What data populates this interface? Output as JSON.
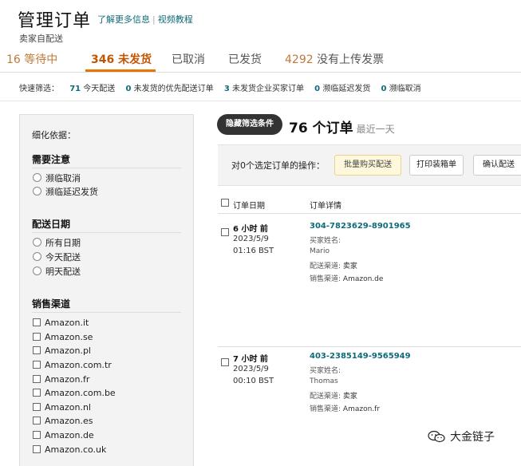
{
  "header": {
    "title": "管理订单",
    "learn_more": "了解更多信息",
    "video": "视频教程",
    "subtitle": "卖家自配送"
  },
  "tabs": {
    "t1": "16 等待中",
    "t2": "346 未发货",
    "t3": "已取消",
    "t4": "已发货",
    "t5_num": "4292",
    "t5_label": "没有上传发票"
  },
  "quick_filter": {
    "label": "快速筛选：",
    "items": [
      {
        "count": "71",
        "label": "今天配送"
      },
      {
        "count": "0",
        "label": "未发货的优先配送订单"
      },
      {
        "count": "3",
        "label": "未发货企业买家订单"
      },
      {
        "count": "0",
        "label": "濒临延迟发货"
      },
      {
        "count": "0",
        "label": "濒临取消"
      }
    ]
  },
  "sidebar": {
    "refine": "细化依据：",
    "attention_title": "需要注意",
    "attention": [
      "濒临取消",
      "濒临延迟发货"
    ],
    "ship_date_title": "配送日期",
    "ship_dates": [
      "所有日期",
      "今天配送",
      "明天配送"
    ],
    "channel_title": "销售渠道",
    "channels": [
      "Amazon.it",
      "Amazon.se",
      "Amazon.pl",
      "Amazon.com.tr",
      "Amazon.fr",
      "Amazon.com.be",
      "Amazon.nl",
      "Amazon.es",
      "Amazon.de",
      "Amazon.co.uk"
    ]
  },
  "main": {
    "filter_button": "隐藏筛选条件",
    "order_count": "76 个订单",
    "range": "最近一天",
    "action_label": "对0个选定订单的操作：",
    "buttons": [
      "批量购买配送",
      "打印装箱单",
      "确认配送"
    ],
    "columns": [
      "订单日期",
      "订单详情"
    ]
  },
  "orders": [
    {
      "when": "6 小时 前",
      "date": "2023/5/9",
      "time": "01:16 BST",
      "order_id": "304-7823629-8901965",
      "buyer_label": "买家姓名:",
      "buyer": "Mario",
      "channel_label": "配送渠道:",
      "channel": "卖家",
      "sales_label": "销售渠道:",
      "sales": "Amazon.de"
    },
    {
      "when": "7 小时 前",
      "date": "2023/5/9",
      "time": "00:10 BST",
      "order_id": "403-2385149-9565949",
      "buyer_label": "买家姓名:",
      "buyer": "Thomas",
      "channel_label": "配送渠道:",
      "channel": "卖家",
      "sales_label": "销售渠道:",
      "sales": "Amazon.fr"
    }
  ],
  "watermark": "大金链子",
  "colors": {
    "accent": "#e77600",
    "link": "#0f6b7a",
    "tab_orange": "#c45500"
  }
}
